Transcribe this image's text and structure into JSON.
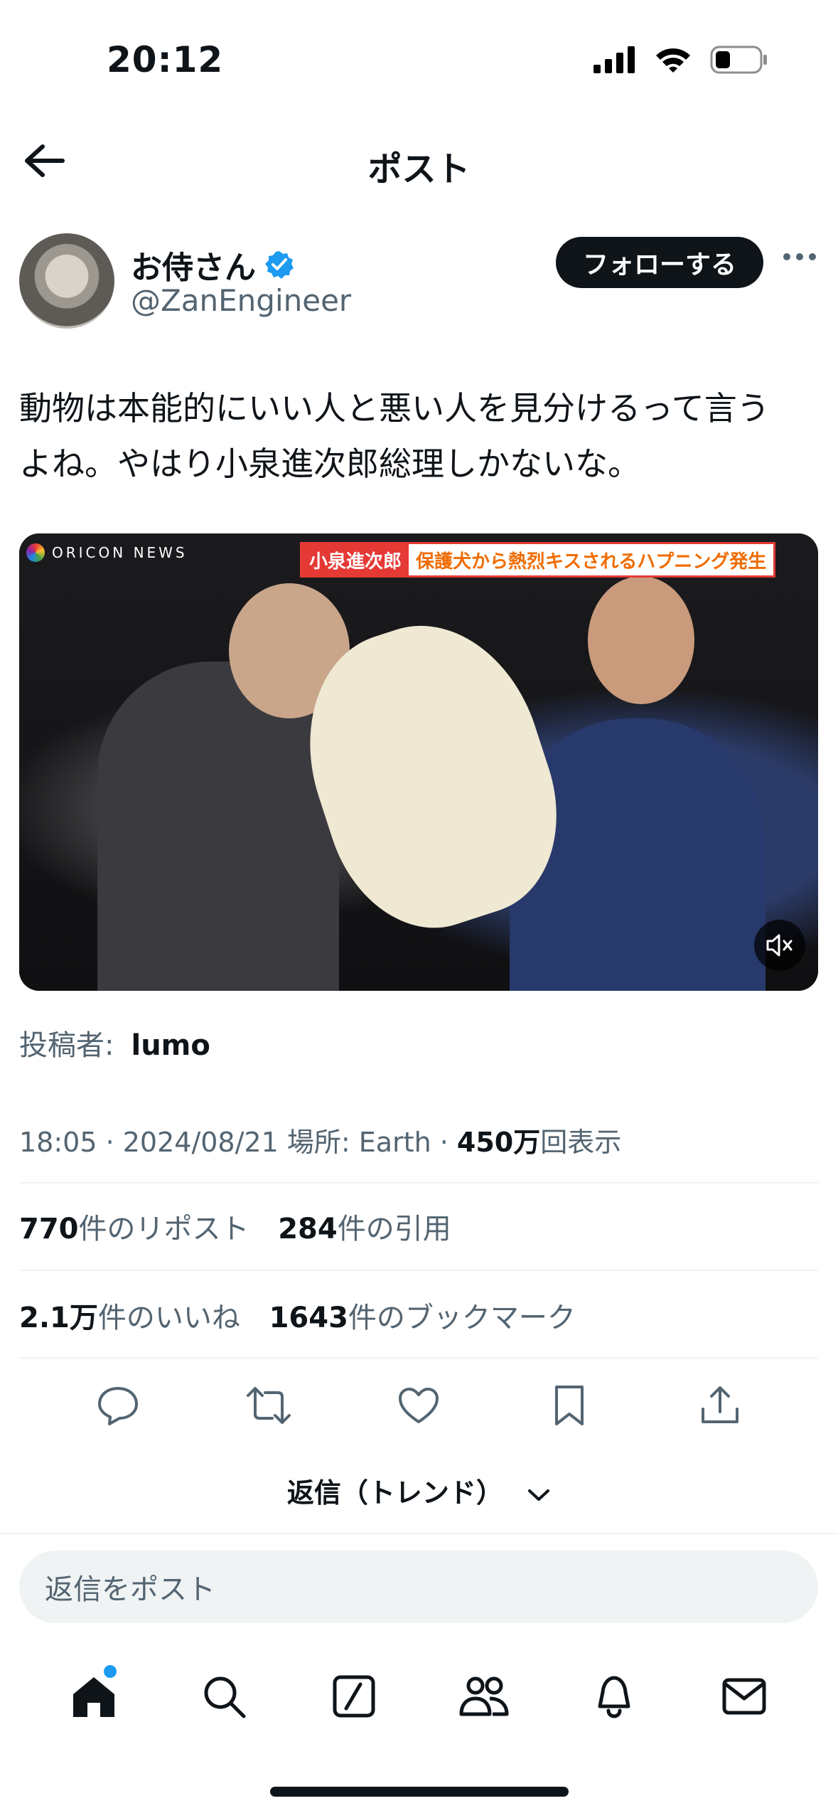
{
  "status_bar": {
    "time": "20:12"
  },
  "header": {
    "title": "ポスト"
  },
  "author": {
    "name": "お侍さん",
    "handle": "@ZanEngineer",
    "follow_label": "フォローする"
  },
  "post": {
    "text_line1": "動物は本能的にいい人と悪い人を見分けるって言う",
    "text_line2": "よね。やはり小泉進次郎総理しかないな。"
  },
  "media": {
    "watermark": "ORICON NEWS",
    "caption_name": "小泉進次郎",
    "caption_text": "保護犬から熱烈キスされるハプニング発生"
  },
  "poster": {
    "label": "投稿者:",
    "name": "lumo"
  },
  "meta": {
    "time_date": "18:05 · 2024/08/21",
    "location": "場所: Earth ·",
    "views_count": "450万",
    "views_label": "回表示"
  },
  "stats": {
    "reposts_count": "770",
    "reposts_label": "件のリポスト",
    "quotes_count": "284",
    "quotes_label": "件の引用",
    "likes_count": "2.1万",
    "likes_label": "件のいいね",
    "bookmarks_count": "1643",
    "bookmarks_label": "件のブックマーク"
  },
  "replies": {
    "sort_label": "返信（トレンド）"
  },
  "reply_box": {
    "placeholder": "返信をポスト"
  },
  "colors": {
    "accent": "#1d9bf0",
    "text": "#0f1419",
    "secondary": "#536471"
  }
}
